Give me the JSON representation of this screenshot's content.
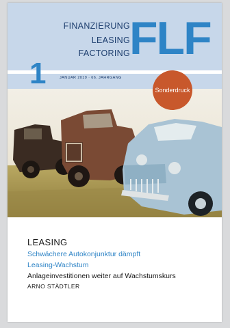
{
  "masthead": {
    "line1": "FINANZIERUNG",
    "line2": "LEASING",
    "line3": "FACTORING",
    "logo": "FLF"
  },
  "issue": {
    "number": "1",
    "date": "JANUAR 2019 · 66. JAHRGANG"
  },
  "stamp": {
    "label": "Sonderdruck"
  },
  "article": {
    "section": "LEASING",
    "headline_1": "Schwächere Autokonjunktur dämpft",
    "headline_2": "Leasing-Wachstum",
    "subline": "Anlageinvestitionen weiter auf Wachstumskurs",
    "author": "ARNO STÄDTLER"
  },
  "colors": {
    "header_bg": "#c7d7ea",
    "brand_blue": "#2e84c6",
    "stamp_orange": "#c8582c"
  }
}
